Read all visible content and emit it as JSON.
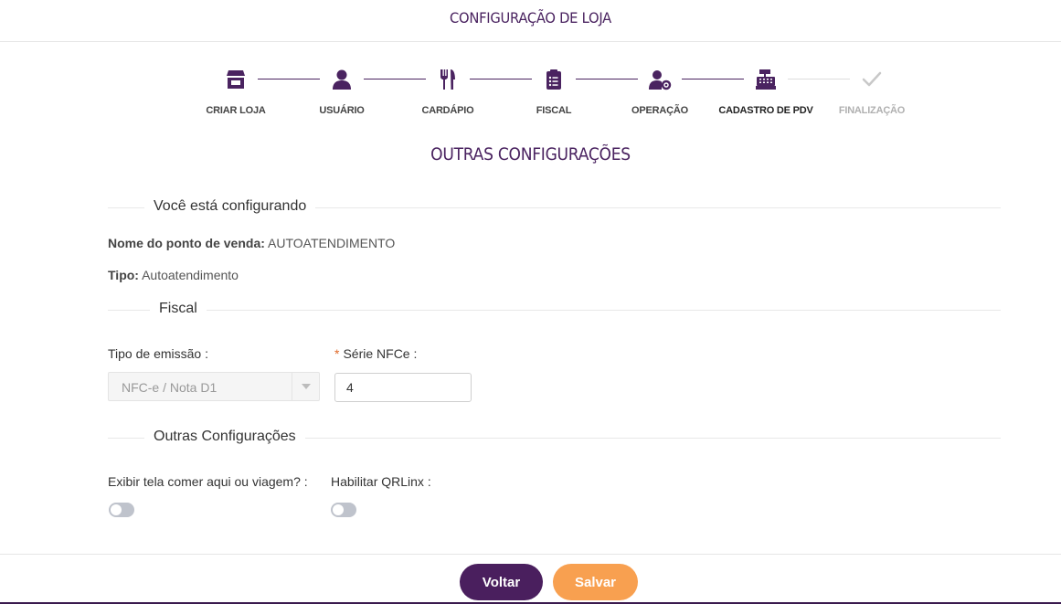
{
  "header": {
    "title": "CONFIGURAÇÃO DE LOJA"
  },
  "stepper": {
    "steps": [
      {
        "label": "CRIAR LOJA",
        "icon": "store-icon"
      },
      {
        "label": "USUÁRIO",
        "icon": "user-icon"
      },
      {
        "label": "CARDÁPIO",
        "icon": "cutlery-icon"
      },
      {
        "label": "FISCAL",
        "icon": "clipboard-icon"
      },
      {
        "label": "OPERAÇÃO",
        "icon": "user-gear-icon"
      },
      {
        "label": "CADASTRO DE PDV",
        "icon": "cash-register-icon"
      },
      {
        "label": "FINALIZAÇÃO",
        "icon": "check-icon"
      }
    ],
    "current_step": "CADASTRO DE PDV",
    "accent_color": "#4a2360",
    "disabled_color": "#c8c8c8"
  },
  "page": {
    "subtitle": "OUTRAS CONFIGURAÇÕES"
  },
  "configuring": {
    "heading": "Você está configurando",
    "pos_name_label": "Nome do ponto de venda:",
    "pos_name_value": "AUTOATENDIMENTO",
    "type_label": "Tipo:",
    "type_value": "Autoatendimento"
  },
  "fiscal": {
    "heading": "Fiscal",
    "emission_label": "Tipo de emissão",
    "emission_value": "NFC-e / Nota D1",
    "series_required_mark": "*",
    "series_label": "Série NFCe",
    "series_value": "4"
  },
  "other": {
    "heading": "Outras Configurações",
    "dine_option_label": "Exibir tela comer aqui ou viagem?",
    "dine_option_enabled": false,
    "qrlinx_label": "Habilitar QRLinx",
    "qrlinx_enabled": false
  },
  "footer": {
    "back_label": "Voltar",
    "save_label": "Salvar",
    "back_color": "#4a1f5e",
    "save_color": "#f8a050"
  }
}
